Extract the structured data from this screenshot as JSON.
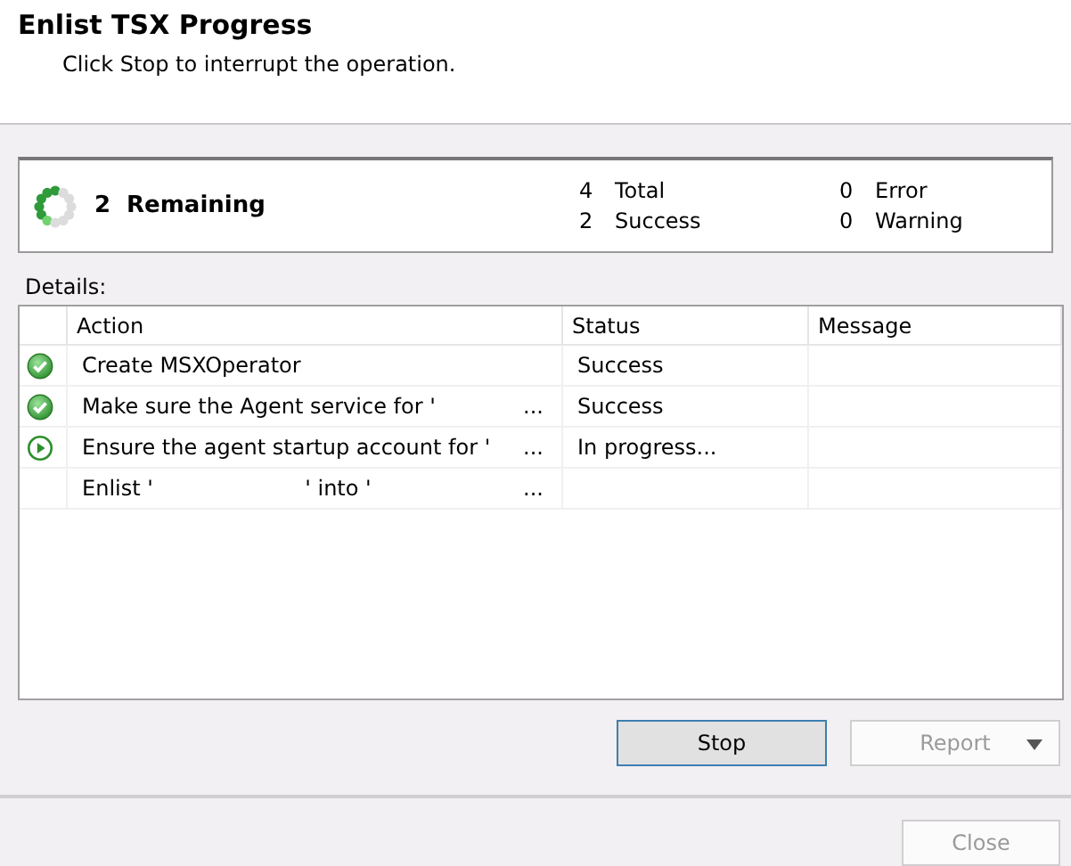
{
  "window": {
    "title": "Enlist TSX Progress",
    "subtitle": "Click Stop to interrupt the operation."
  },
  "summary": {
    "level": 0.5,
    "remaining_count": "2",
    "remaining_label": "Remaining",
    "counts": [
      {
        "value": "4",
        "label": "Total"
      },
      {
        "value": "0",
        "label": "Error"
      },
      {
        "value": "2",
        "label": "Success"
      },
      {
        "value": "0",
        "label": "Warning"
      }
    ]
  },
  "details_label": "Details:",
  "table": {
    "columns": [
      "Action",
      "Status",
      "Message"
    ],
    "rows": [
      {
        "kind": "success",
        "action": [
          "Create MSXOperator"
        ],
        "status": "Success"
      },
      {
        "kind": "success",
        "action": [
          "Make sure the Agent service for '",
          "..."
        ],
        "status": "Success"
      },
      {
        "kind": "running",
        "action": [
          "Ensure the agent startup account for '",
          "..."
        ],
        "status": "In progress..."
      },
      {
        "kind": "pending",
        "action": [
          "Enlist '",
          "' into '",
          "..."
        ],
        "status": ""
      }
    ]
  },
  "buttons": [
    {
      "label": "Stop",
      "disabled": false,
      "dropdown": false
    },
    {
      "label": "Report",
      "disabled": true,
      "dropdown": true
    }
  ],
  "footer_buttons": [
    {
      "label": "Close",
      "disabled": true
    }
  ]
}
